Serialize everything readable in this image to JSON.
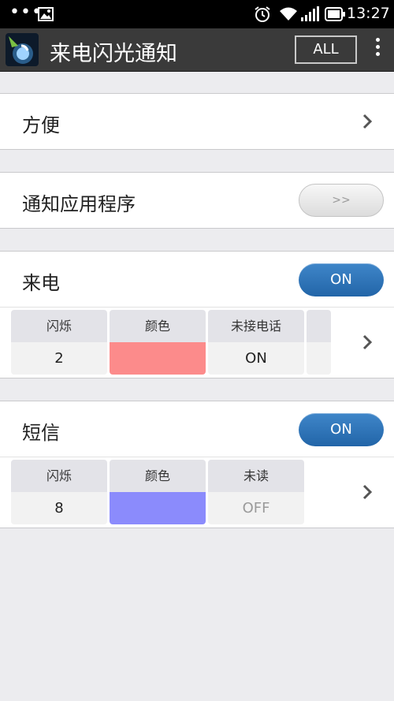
{
  "status_bar": {
    "time": "13:27",
    "icons": [
      "more-dots-icon",
      "image-icon",
      "alarm-icon",
      "wifi-icon",
      "signal-icon",
      "battery-icon"
    ]
  },
  "app_bar": {
    "title": "来电闪光通知",
    "all_button": "ALL"
  },
  "sections": {
    "convenience": {
      "label": "方便"
    },
    "notify_apps": {
      "label": "通知应用程序",
      "button": ">>"
    },
    "incoming_call": {
      "label": "来电",
      "toggle": "ON",
      "cells": {
        "flash": {
          "header": "闪烁",
          "value": "2"
        },
        "color": {
          "header": "颜色",
          "color_hex": "#fc8b8b"
        },
        "missed": {
          "header": "未接电话",
          "value": "ON"
        }
      }
    },
    "sms": {
      "label": "短信",
      "toggle": "ON",
      "cells": {
        "flash": {
          "header": "闪烁",
          "value": "8"
        },
        "color": {
          "header": "颜色",
          "color_hex": "#8b8bfc"
        },
        "unread": {
          "header": "未读",
          "value": "OFF"
        }
      }
    }
  },
  "colors": {
    "accent_toggle": "#2d73b8",
    "app_bar": "#3a3a3a",
    "background": "#ececef"
  }
}
